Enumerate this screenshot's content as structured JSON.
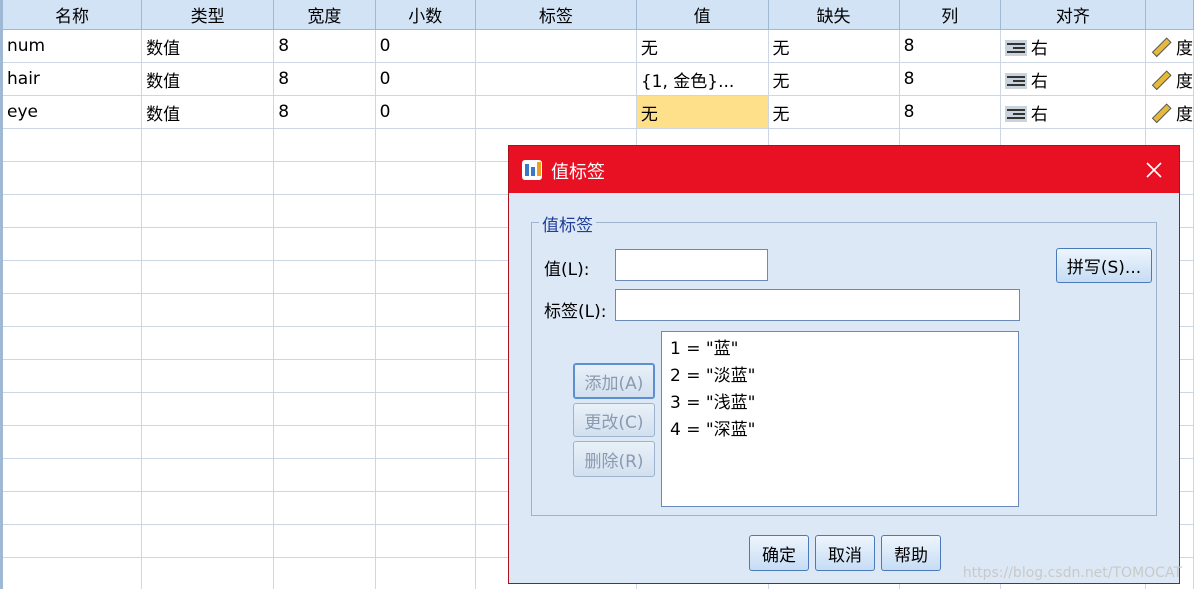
{
  "grid": {
    "columns": [
      "名称",
      "类型",
      "宽度",
      "小数",
      "标签",
      "值",
      "缺失",
      "列",
      "对齐",
      ""
    ],
    "rows": [
      {
        "name": "num",
        "type": "数值",
        "width": "8",
        "decimals": "0",
        "label": "",
        "values": "无",
        "missing": "无",
        "columns": "8",
        "align": "右",
        "measure": "度"
      },
      {
        "name": "hair",
        "type": "数值",
        "width": "8",
        "decimals": "0",
        "label": "",
        "values": "{1, 金色}...",
        "missing": "无",
        "columns": "8",
        "align": "右",
        "measure": "度"
      },
      {
        "name": "eye",
        "type": "数值",
        "width": "8",
        "decimals": "0",
        "label": "",
        "values": "无",
        "missing": "无",
        "columns": "8",
        "align": "右",
        "measure": "度"
      }
    ]
  },
  "dialog": {
    "title": "值标签",
    "group_label": "值标签",
    "value_label": "值(L):",
    "value_input": "",
    "label_label": "标签(L):",
    "label_input": "",
    "spell_button": "拼写(S)...",
    "add_button": "添加(A)",
    "change_button": "更改(C)",
    "delete_button": "删除(R)",
    "list_items": [
      "1 = \"蓝\"",
      "2 = \"淡蓝\"",
      "3 = \"浅蓝\"",
      "4 = \"深蓝\""
    ],
    "ok_button": "确定",
    "cancel_button": "取消",
    "help_button": "帮助"
  },
  "watermark": "https://blog.csdn.net/TOMOCAT",
  "colors": {
    "titlebar": "#e81123",
    "header": "#d3e3f6",
    "selected_cell": "#ffe08a",
    "dialog_bg": "#dce8f5"
  }
}
